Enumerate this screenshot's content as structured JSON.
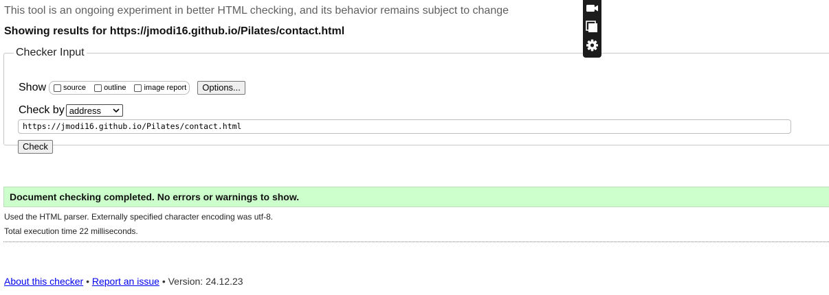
{
  "intro_text": "This tool is an ongoing experiment in better HTML checking, and its behavior remains subject to change",
  "showing_text": "Showing results for https://jmodi16.github.io/Pilates/contact.html",
  "checker": {
    "legend": "Checker Input",
    "show_label": "Show",
    "show_options": [
      {
        "label": "source",
        "checked": false
      },
      {
        "label": "outline",
        "checked": false
      },
      {
        "label": "image report",
        "checked": false
      }
    ],
    "options_button": "Options...",
    "check_by_label": "Check by",
    "check_by_selected": "address",
    "url_value": "https://jmodi16.github.io/Pilates/contact.html",
    "check_button": "Check"
  },
  "overlay_icons": [
    "video-camera-icon",
    "windows-icon",
    "gear-icon"
  ],
  "result": {
    "success_message": "Document checking completed. No errors or warnings to show.",
    "parser_info": "Used the HTML parser. Externally specified character encoding was utf-8.",
    "execution_time": "Total execution time 22 milliseconds."
  },
  "footer": {
    "about_link": "About this checker",
    "separator": "•",
    "report_link": "Report an issue",
    "version": "Version: 24.12.23"
  },
  "colors": {
    "success_background": "#ccffcc",
    "link": "#0000ee",
    "overlay_background": "#1c1c1c"
  }
}
